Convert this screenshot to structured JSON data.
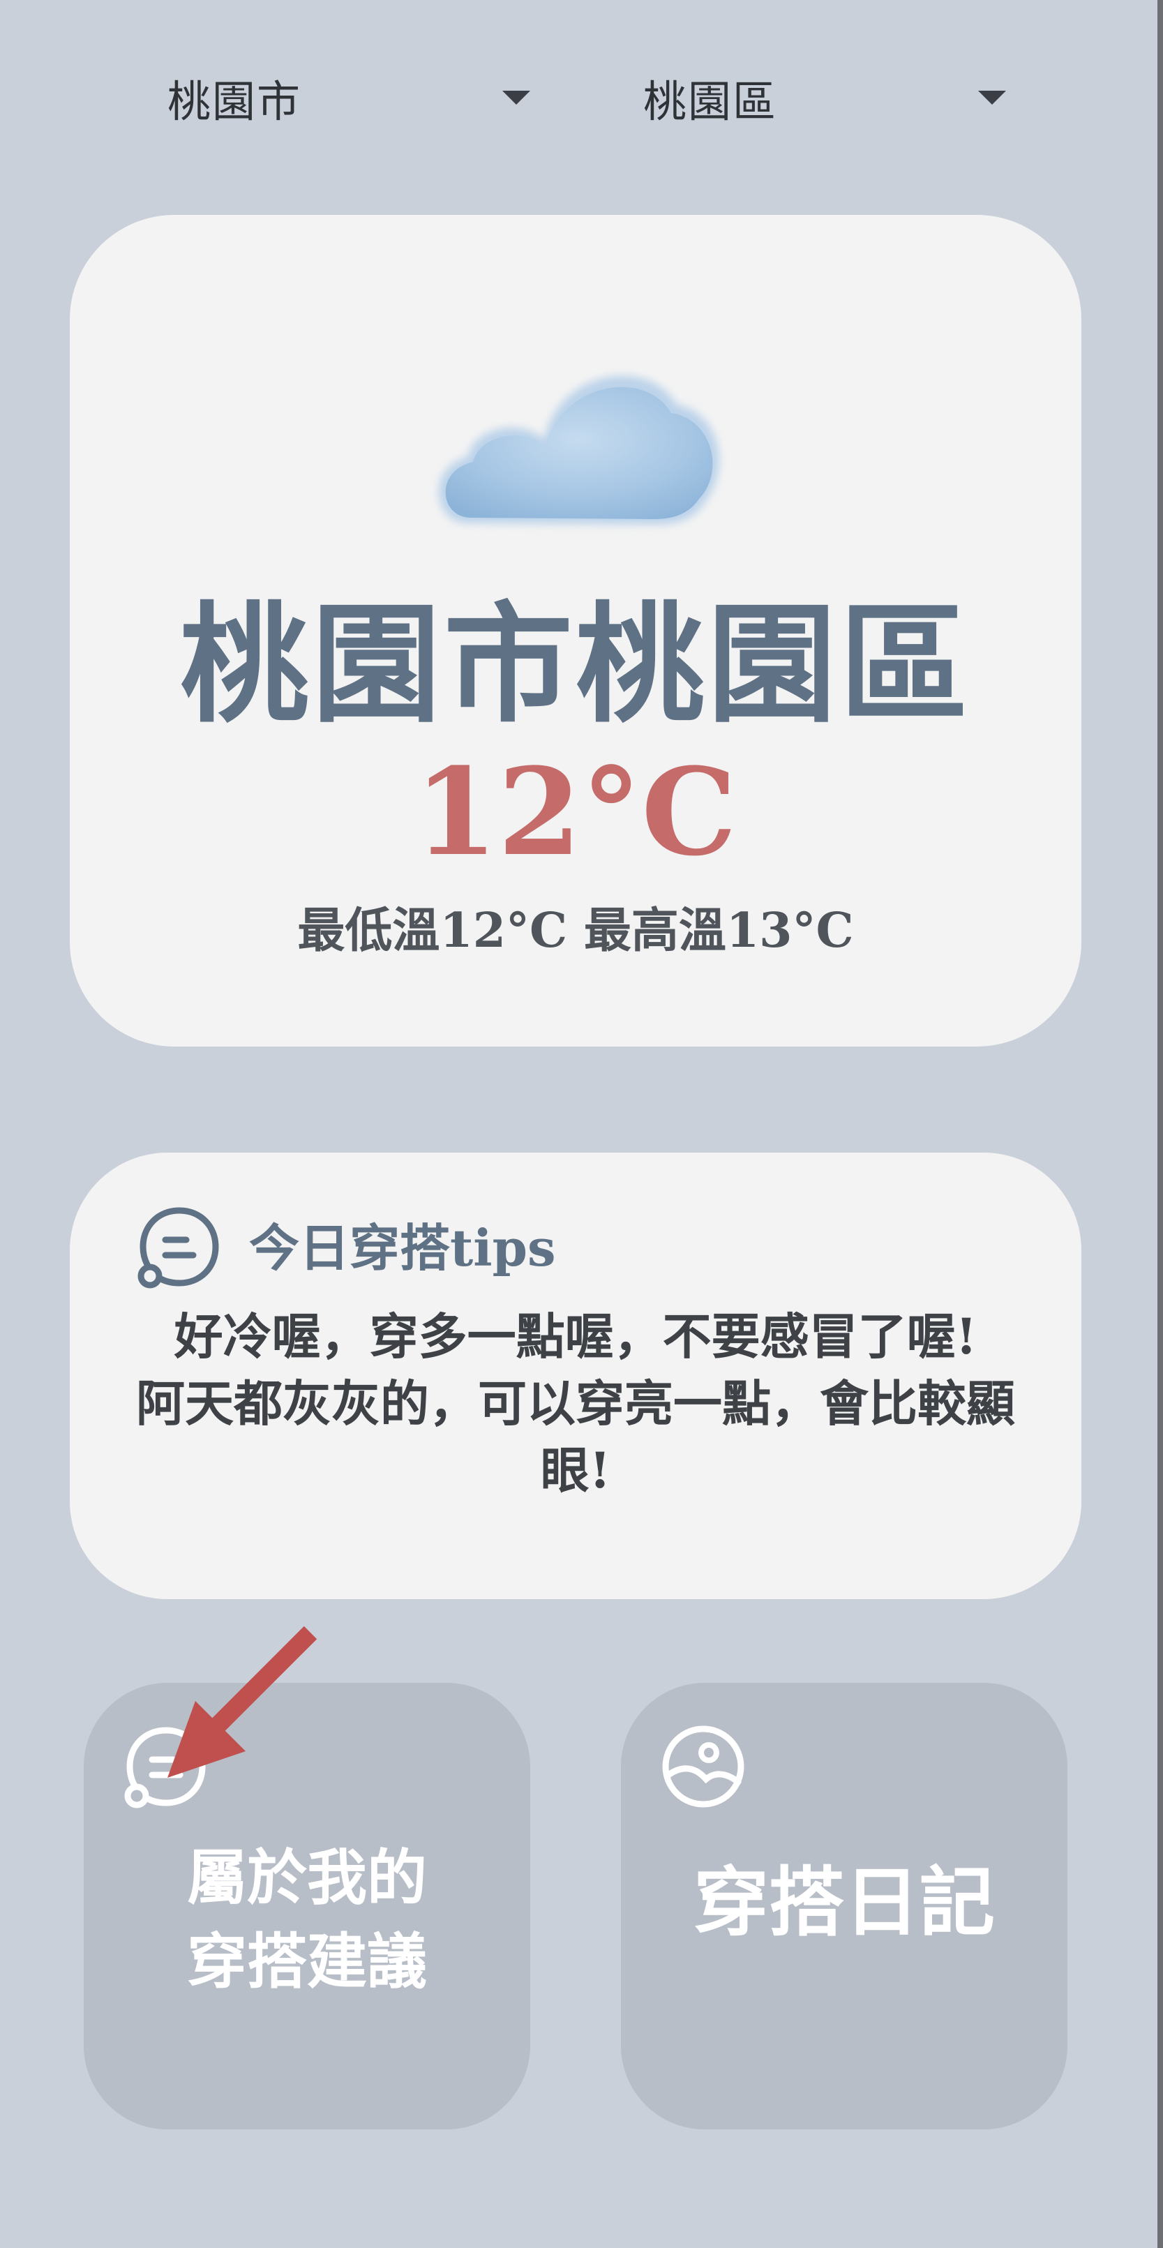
{
  "selectors": {
    "city": "桃園市",
    "district": "桃園區"
  },
  "weather": {
    "icon": "cloud-icon",
    "location": "桃園市桃園區",
    "temperature": "12°C",
    "min_max": "最低溫12°C 最高溫13°C"
  },
  "tips": {
    "icon": "chat-bubble-icon",
    "title": "今日穿搭tips",
    "body": "好冷喔，穿多一點喔，不要感冒了喔!\n阿天都灰灰的，可以穿亮一點，會比較顯眼!"
  },
  "tiles": {
    "advice": {
      "icon": "chat-bubble-icon",
      "label": "屬於我的\n穿搭建議"
    },
    "diary": {
      "icon": "image-icon",
      "label": "穿搭日記"
    }
  },
  "colors": {
    "background": "#c9d0da",
    "card": "#f3f3f3",
    "tile": "#b8bec7",
    "title": "#5f7185",
    "temperature": "#c56b69",
    "annotation_arrow": "#c0504d"
  }
}
